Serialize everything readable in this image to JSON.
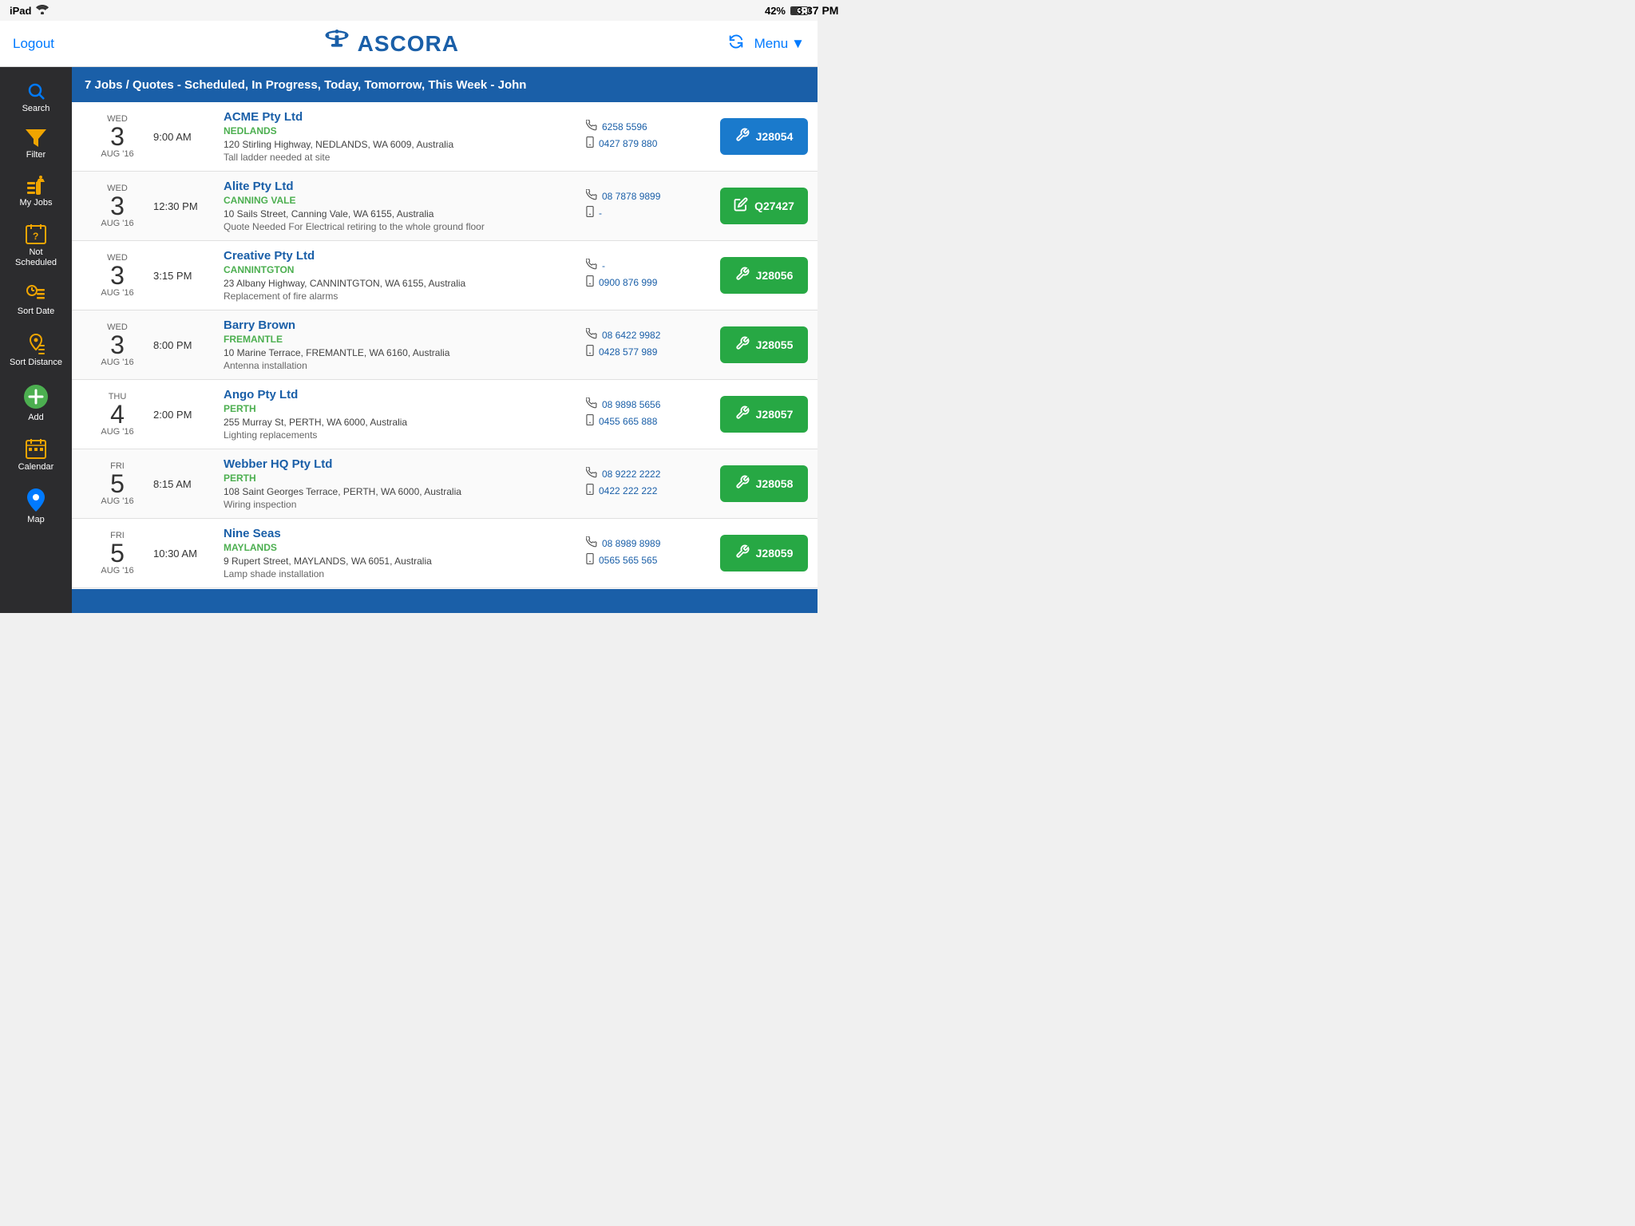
{
  "statusBar": {
    "device": "iPad",
    "wifi": "wifi",
    "time": "3:37 PM",
    "battery": "42%"
  },
  "header": {
    "logout": "Logout",
    "brand": "Ascora",
    "menu": "Menu"
  },
  "contentHeader": {
    "title": "7 Jobs / Quotes - Scheduled, In Progress, Today, Tomorrow, This Week - John"
  },
  "sidebar": {
    "items": [
      {
        "id": "search",
        "label": "Search",
        "icon": "🔍"
      },
      {
        "id": "filter",
        "label": "Filter",
        "icon": "⬛"
      },
      {
        "id": "my-jobs",
        "label": "My Jobs",
        "icon": "🔨"
      },
      {
        "id": "not-scheduled",
        "label": "Not Scheduled",
        "icon": "📅"
      },
      {
        "id": "sort-date",
        "label": "Sort Date",
        "icon": "🕐"
      },
      {
        "id": "sort-distance",
        "label": "Sort Distance",
        "icon": "📍"
      },
      {
        "id": "add",
        "label": "Add",
        "icon": "➕"
      },
      {
        "id": "calendar",
        "label": "Calendar",
        "icon": "📅"
      },
      {
        "id": "map",
        "label": "Map",
        "icon": "📍"
      }
    ]
  },
  "jobs": [
    {
      "id": "J28054",
      "dayName": "WED",
      "dateNum": "3",
      "dateMonth": "AUG '16",
      "time": "9:00 AM",
      "company": "ACME Pty Ltd",
      "suburb": "NEDLANDS",
      "address": "120 Stirling Highway, NEDLANDS, WA 6009, Australia",
      "notes": "Tall ladder needed at site",
      "phone": "6258 5596",
      "mobile": "0427 879 880",
      "buttonType": "blue",
      "buttonIcon": "🔧",
      "isQuote": false
    },
    {
      "id": "Q27427",
      "dayName": "WED",
      "dateNum": "3",
      "dateMonth": "AUG '16",
      "time": "12:30 PM",
      "company": "Alite Pty Ltd",
      "suburb": "CANNING VALE",
      "address": "10 Sails Street, Canning Vale, WA 6155, Australia",
      "notes": "Quote Needed For Electrical retiring to the whole ground floor",
      "phone": "08 7878 9899",
      "mobile": "-",
      "buttonType": "green",
      "buttonIcon": "✏️",
      "isQuote": true
    },
    {
      "id": "J28056",
      "dayName": "WED",
      "dateNum": "3",
      "dateMonth": "AUG '16",
      "time": "3:15 PM",
      "company": "Creative Pty Ltd",
      "suburb": "CANNINTGTON",
      "address": "23 Albany Highway, CANNINTGTON, WA 6155, Australia",
      "notes": "Replacement of fire alarms",
      "phone": "-",
      "mobile": "0900 876 999",
      "buttonType": "green",
      "buttonIcon": "🔧",
      "isQuote": false
    },
    {
      "id": "J28055",
      "dayName": "WED",
      "dateNum": "3",
      "dateMonth": "AUG '16",
      "time": "8:00 PM",
      "company": "Barry Brown",
      "suburb": "FREMANTLE",
      "address": "10 Marine Terrace, FREMANTLE, WA 6160, Australia",
      "notes": "Antenna installation",
      "phone": "08 6422 9982",
      "mobile": "0428 577 989",
      "buttonType": "green",
      "buttonIcon": "🔧",
      "isQuote": false
    },
    {
      "id": "J28057",
      "dayName": "THU",
      "dateNum": "4",
      "dateMonth": "AUG '16",
      "time": "2:00 PM",
      "company": "Ango Pty Ltd",
      "suburb": "PERTH",
      "address": "255 Murray St, PERTH, WA 6000, Australia",
      "notes": "Lighting replacements",
      "phone": "08 9898 5656",
      "mobile": "0455 665 888",
      "buttonType": "green",
      "buttonIcon": "🔧",
      "isQuote": false
    },
    {
      "id": "J28058",
      "dayName": "FRI",
      "dateNum": "5",
      "dateMonth": "AUG '16",
      "time": "8:15 AM",
      "company": "Webber HQ Pty Ltd",
      "suburb": "PERTH",
      "address": "108 Saint Georges Terrace, PERTH, WA 6000, Australia",
      "notes": "Wiring inspection",
      "phone": "08 9222 2222",
      "mobile": "0422 222 222",
      "buttonType": "green",
      "buttonIcon": "🔧",
      "isQuote": false
    },
    {
      "id": "J28059",
      "dayName": "FRI",
      "dateNum": "5",
      "dateMonth": "AUG '16",
      "time": "10:30 AM",
      "company": "Nine Seas",
      "suburb": "MAYLANDS",
      "address": "9 Rupert Street, MAYLANDS, WA 6051, Australia",
      "notes": "Lamp shade installation",
      "phone": "08 8989 8989",
      "mobile": "0565 565 565",
      "buttonType": "green",
      "buttonIcon": "🔧",
      "isQuote": false
    }
  ]
}
